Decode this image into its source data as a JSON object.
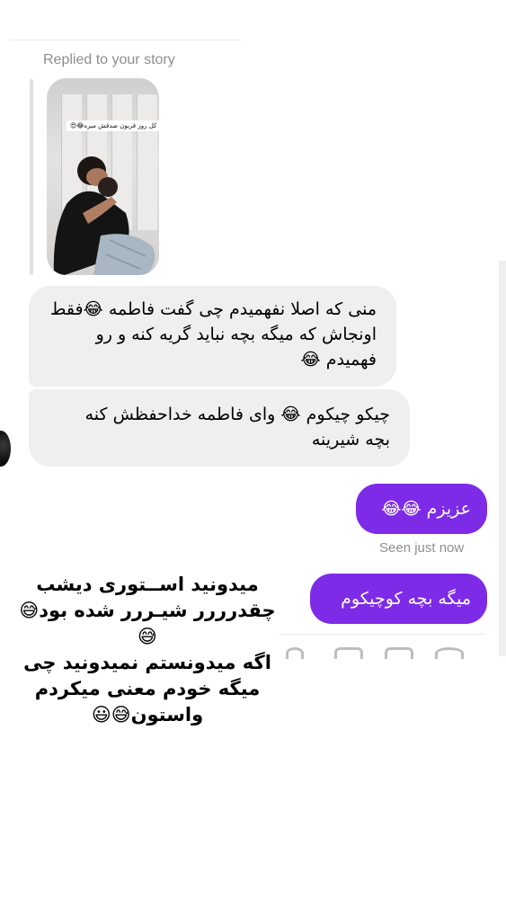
{
  "story_reply": {
    "label": "Replied to your story",
    "thumbnail_caption": "کل روز قربون صدقش میره😂😍"
  },
  "messages": [
    {
      "direction": "incoming",
      "text": "منی که اصلا نفهمیدم چی گفت فاطمه 😂فقط\nاونجاش که میگه بچه نباید گریه کنه و رو\nفهمیدم 😂"
    },
    {
      "direction": "incoming",
      "text": "چیکو چیکوم 😂 وای فاطمه خداحفظش کنه\nبچه شیرینه"
    },
    {
      "direction": "outgoing",
      "text": "عزیزم 😂😂"
    },
    {
      "direction": "outgoing",
      "text": "میگه بچه کوچیکوم"
    }
  ],
  "status": {
    "seen": "Seen just now"
  },
  "overlay_text": "میدونید اســتوری دیشب\nچقدرررر شیـررر شده بود😅\n😅\nاگه میدونستم نمیدونید چی\nمیگه  خودم معنی میکردم\nواستون😅😃",
  "colors": {
    "outgoing_bubble": "#7e2be8",
    "incoming_bubble": "#efefef",
    "meta_text": "#8e8e8e"
  },
  "icons": [
    "attach-icon",
    "image-icon",
    "sticker-icon",
    "mic-icon"
  ]
}
